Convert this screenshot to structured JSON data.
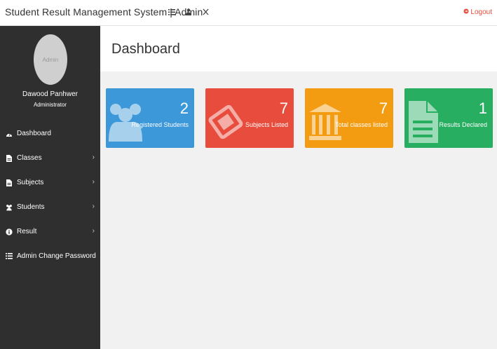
{
  "topbar": {
    "brand": "Student Result Management System | Admin",
    "icons": [
      "list-icon",
      "user-icon",
      "close-icon"
    ],
    "logout": "Logout"
  },
  "sidebar": {
    "avatar_text": "Admin",
    "user_name": "Dawood Panhwer",
    "user_role": "Administrator",
    "items": [
      {
        "label": "Dashboard",
        "icon": "dashboard-icon",
        "has_children": false
      },
      {
        "label": "Classes",
        "icon": "file-icon",
        "has_children": true
      },
      {
        "label": "Subjects",
        "icon": "file-icon",
        "has_children": true
      },
      {
        "label": "Students",
        "icon": "users-icon",
        "has_children": true
      },
      {
        "label": "Result",
        "icon": "info-icon",
        "has_children": true
      },
      {
        "label": "Admin Change Password",
        "icon": "list-icon",
        "has_children": false
      }
    ]
  },
  "main": {
    "title": "Dashboard",
    "cards": [
      {
        "value": "2",
        "label": "Registered Students",
        "color": "#3c98d8",
        "icon": "users-icon"
      },
      {
        "value": "7",
        "label": "Subjects Listed",
        "color": "#e74c3c",
        "icon": "ticket-icon"
      },
      {
        "value": "7",
        "label": "Total classes listed",
        "color": "#f39c12",
        "icon": "bank-icon"
      },
      {
        "value": "1",
        "label": "Results Declared",
        "color": "#27ae60",
        "icon": "file-icon"
      }
    ]
  }
}
